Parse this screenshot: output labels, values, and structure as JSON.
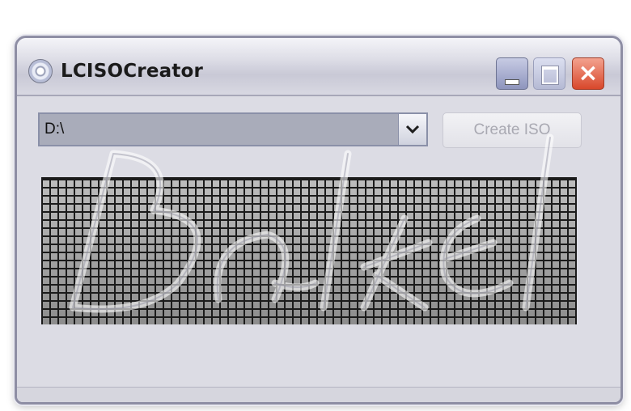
{
  "window": {
    "title": "LCISOCreator"
  },
  "drive_select": {
    "selected": "D:\\"
  },
  "create_button": {
    "label": "Create ISO",
    "enabled": false
  },
  "colors": {
    "titlebar": "#dfdfe8",
    "close_button": "#d8472b",
    "window_bg": "#dcdce4"
  },
  "icons": {
    "app": "disc-icon",
    "minimize": "minimize-icon",
    "maximize": "maximize-icon",
    "close": "close-icon",
    "dropdown": "chevron-down-icon"
  }
}
